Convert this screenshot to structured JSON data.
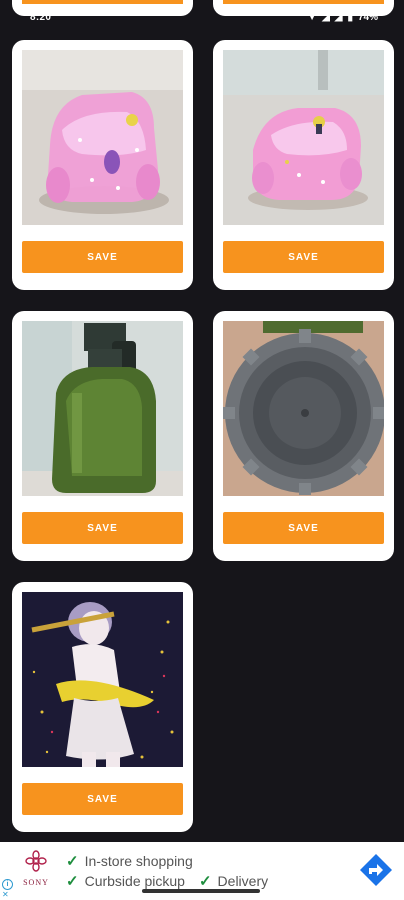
{
  "status_bar": {
    "time": "8:20",
    "battery": "74%"
  },
  "cards": [
    {
      "save_label": "SAVE",
      "image": "pink-resin-car"
    },
    {
      "save_label": "SAVE",
      "image": "pink-resin-car-angle"
    },
    {
      "save_label": "SAVE",
      "image": "green-pump-bottle"
    },
    {
      "save_label": "SAVE",
      "image": "gray-bottle-cap"
    },
    {
      "save_label": "SAVE",
      "image": "krishna-statue"
    }
  ],
  "ad": {
    "brand": "SONY",
    "line1": "In-store shopping",
    "line2a": "Curbside pickup",
    "line2b": "Delivery",
    "accent": "#1a73e8",
    "check_color": "#1e8e3e"
  },
  "colors": {
    "background": "#16151a",
    "button": "#f7931e",
    "card": "#ffffff"
  }
}
